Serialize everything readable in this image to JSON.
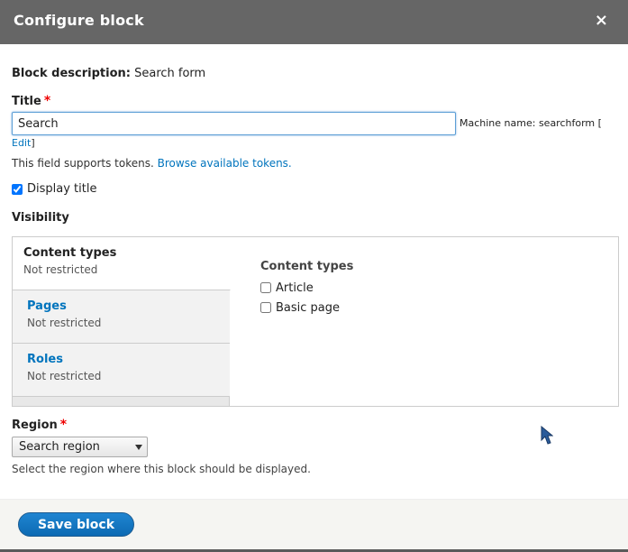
{
  "dialog": {
    "title": "Configure block",
    "close_glyph": "×"
  },
  "form": {
    "block_description_label": "Block description:",
    "block_description_value": "Search form",
    "title_label": "Title",
    "required_mark": "*",
    "title_value": "Search",
    "machine_name_text": "Machine name: searchform [",
    "edit_link": "Edit",
    "edit_close": "]",
    "tokens_text": "This field supports tokens.",
    "tokens_link": "Browse available tokens.",
    "display_title_label": "Display title",
    "display_title_checked": true,
    "visibility_label": "Visibility",
    "region_label": "Region",
    "region_value": "Search region",
    "region_help": "Select the region where this block should be displayed."
  },
  "visibility_tabs": [
    {
      "title": "Content types",
      "summary": "Not restricted",
      "active": true
    },
    {
      "title": "Pages",
      "summary": "Not restricted",
      "active": false
    },
    {
      "title": "Roles",
      "summary": "Not restricted",
      "active": false
    }
  ],
  "content_types_pane": {
    "title": "Content types",
    "options": [
      {
        "label": "Article",
        "checked": false
      },
      {
        "label": "Basic page",
        "checked": false
      }
    ]
  },
  "footer": {
    "save_label": "Save block"
  },
  "colors": {
    "titlebar": "#666666",
    "link": "#0074bd",
    "required": "#e00000",
    "primary_button": "#0c6ab3"
  }
}
